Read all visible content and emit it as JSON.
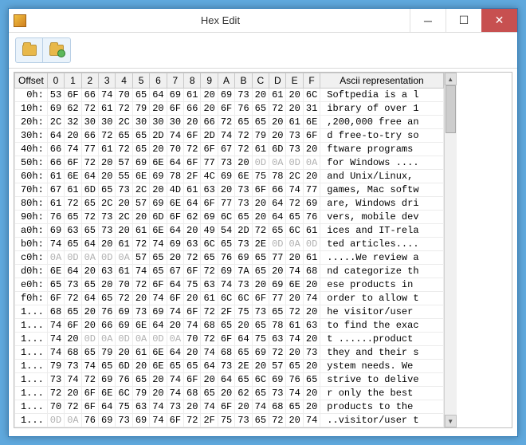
{
  "window": {
    "title": "Hex Edit"
  },
  "columns": {
    "offset": "Offset",
    "hex": [
      "0",
      "1",
      "2",
      "3",
      "4",
      "5",
      "6",
      "7",
      "8",
      "9",
      "A",
      "B",
      "C",
      "D",
      "E",
      "F"
    ],
    "ascii": "Ascii representation"
  },
  "rows": [
    {
      "offset": "0h:",
      "bytes": [
        "53",
        "6F",
        "66",
        "74",
        "70",
        "65",
        "64",
        "69",
        "61",
        "20",
        "69",
        "73",
        "20",
        "61",
        "20",
        "6C"
      ],
      "gray": [],
      "ascii": "Softpedia is a l"
    },
    {
      "offset": "10h:",
      "bytes": [
        "69",
        "62",
        "72",
        "61",
        "72",
        "79",
        "20",
        "6F",
        "66",
        "20",
        "6F",
        "76",
        "65",
        "72",
        "20",
        "31"
      ],
      "gray": [],
      "ascii": "ibrary of over 1"
    },
    {
      "offset": "20h:",
      "bytes": [
        "2C",
        "32",
        "30",
        "30",
        "2C",
        "30",
        "30",
        "30",
        "20",
        "66",
        "72",
        "65",
        "65",
        "20",
        "61",
        "6E"
      ],
      "gray": [],
      "ascii": ",200,000 free an"
    },
    {
      "offset": "30h:",
      "bytes": [
        "64",
        "20",
        "66",
        "72",
        "65",
        "65",
        "2D",
        "74",
        "6F",
        "2D",
        "74",
        "72",
        "79",
        "20",
        "73",
        "6F"
      ],
      "gray": [],
      "ascii": "d free-to-try so"
    },
    {
      "offset": "40h:",
      "bytes": [
        "66",
        "74",
        "77",
        "61",
        "72",
        "65",
        "20",
        "70",
        "72",
        "6F",
        "67",
        "72",
        "61",
        "6D",
        "73",
        "20"
      ],
      "gray": [],
      "ascii": "ftware programs "
    },
    {
      "offset": "50h:",
      "bytes": [
        "66",
        "6F",
        "72",
        "20",
        "57",
        "69",
        "6E",
        "64",
        "6F",
        "77",
        "73",
        "20",
        "0D",
        "0A",
        "0D",
        "0A"
      ],
      "gray": [
        12,
        13,
        14,
        15
      ],
      "ascii": "for Windows ...."
    },
    {
      "offset": "60h:",
      "bytes": [
        "61",
        "6E",
        "64",
        "20",
        "55",
        "6E",
        "69",
        "78",
        "2F",
        "4C",
        "69",
        "6E",
        "75",
        "78",
        "2C",
        "20"
      ],
      "gray": [],
      "ascii": "and Unix/Linux, "
    },
    {
      "offset": "70h:",
      "bytes": [
        "67",
        "61",
        "6D",
        "65",
        "73",
        "2C",
        "20",
        "4D",
        "61",
        "63",
        "20",
        "73",
        "6F",
        "66",
        "74",
        "77"
      ],
      "gray": [],
      "ascii": "games, Mac softw"
    },
    {
      "offset": "80h:",
      "bytes": [
        "61",
        "72",
        "65",
        "2C",
        "20",
        "57",
        "69",
        "6E",
        "64",
        "6F",
        "77",
        "73",
        "20",
        "64",
        "72",
        "69"
      ],
      "gray": [],
      "ascii": "are, Windows dri"
    },
    {
      "offset": "90h:",
      "bytes": [
        "76",
        "65",
        "72",
        "73",
        "2C",
        "20",
        "6D",
        "6F",
        "62",
        "69",
        "6C",
        "65",
        "20",
        "64",
        "65",
        "76"
      ],
      "gray": [],
      "ascii": "vers, mobile dev"
    },
    {
      "offset": "a0h:",
      "bytes": [
        "69",
        "63",
        "65",
        "73",
        "20",
        "61",
        "6E",
        "64",
        "20",
        "49",
        "54",
        "2D",
        "72",
        "65",
        "6C",
        "61"
      ],
      "gray": [],
      "ascii": "ices and IT-rela"
    },
    {
      "offset": "b0h:",
      "bytes": [
        "74",
        "65",
        "64",
        "20",
        "61",
        "72",
        "74",
        "69",
        "63",
        "6C",
        "65",
        "73",
        "2E",
        "0D",
        "0A",
        "0D"
      ],
      "gray": [
        13,
        14,
        15
      ],
      "ascii": "ted articles...."
    },
    {
      "offset": "c0h:",
      "bytes": [
        "0A",
        "0D",
        "0A",
        "0D",
        "0A",
        "57",
        "65",
        "20",
        "72",
        "65",
        "76",
        "69",
        "65",
        "77",
        "20",
        "61"
      ],
      "gray": [
        0,
        1,
        2,
        3,
        4
      ],
      "ascii": ".....We review a"
    },
    {
      "offset": "d0h:",
      "bytes": [
        "6E",
        "64",
        "20",
        "63",
        "61",
        "74",
        "65",
        "67",
        "6F",
        "72",
        "69",
        "7A",
        "65",
        "20",
        "74",
        "68"
      ],
      "gray": [],
      "ascii": "nd categorize th"
    },
    {
      "offset": "e0h:",
      "bytes": [
        "65",
        "73",
        "65",
        "20",
        "70",
        "72",
        "6F",
        "64",
        "75",
        "63",
        "74",
        "73",
        "20",
        "69",
        "6E",
        "20"
      ],
      "gray": [],
      "ascii": "ese products in "
    },
    {
      "offset": "f0h:",
      "bytes": [
        "6F",
        "72",
        "64",
        "65",
        "72",
        "20",
        "74",
        "6F",
        "20",
        "61",
        "6C",
        "6C",
        "6F",
        "77",
        "20",
        "74"
      ],
      "gray": [],
      "ascii": "order to allow t"
    },
    {
      "offset": "1...",
      "bytes": [
        "68",
        "65",
        "20",
        "76",
        "69",
        "73",
        "69",
        "74",
        "6F",
        "72",
        "2F",
        "75",
        "73",
        "65",
        "72",
        "20"
      ],
      "gray": [],
      "ascii": "he visitor/user "
    },
    {
      "offset": "1...",
      "bytes": [
        "74",
        "6F",
        "20",
        "66",
        "69",
        "6E",
        "64",
        "20",
        "74",
        "68",
        "65",
        "20",
        "65",
        "78",
        "61",
        "63"
      ],
      "gray": [],
      "ascii": "to find the exac"
    },
    {
      "offset": "1...",
      "bytes": [
        "74",
        "20",
        "0D",
        "0A",
        "0D",
        "0A",
        "0D",
        "0A",
        "70",
        "72",
        "6F",
        "64",
        "75",
        "63",
        "74",
        "20"
      ],
      "gray": [
        2,
        3,
        4,
        5,
        6,
        7
      ],
      "ascii": "t ......product "
    },
    {
      "offset": "1...",
      "bytes": [
        "74",
        "68",
        "65",
        "79",
        "20",
        "61",
        "6E",
        "64",
        "20",
        "74",
        "68",
        "65",
        "69",
        "72",
        "20",
        "73"
      ],
      "gray": [],
      "ascii": "they and their s"
    },
    {
      "offset": "1...",
      "bytes": [
        "79",
        "73",
        "74",
        "65",
        "6D",
        "20",
        "6E",
        "65",
        "65",
        "64",
        "73",
        "2E",
        "20",
        "57",
        "65",
        "20"
      ],
      "gray": [],
      "ascii": "ystem needs. We "
    },
    {
      "offset": "1...",
      "bytes": [
        "73",
        "74",
        "72",
        "69",
        "76",
        "65",
        "20",
        "74",
        "6F",
        "20",
        "64",
        "65",
        "6C",
        "69",
        "76",
        "65"
      ],
      "gray": [],
      "ascii": "strive to delive"
    },
    {
      "offset": "1...",
      "bytes": [
        "72",
        "20",
        "6F",
        "6E",
        "6C",
        "79",
        "20",
        "74",
        "68",
        "65",
        "20",
        "62",
        "65",
        "73",
        "74",
        "20"
      ],
      "gray": [],
      "ascii": "r only the best "
    },
    {
      "offset": "1...",
      "bytes": [
        "70",
        "72",
        "6F",
        "64",
        "75",
        "63",
        "74",
        "73",
        "20",
        "74",
        "6F",
        "20",
        "74",
        "68",
        "65",
        "20"
      ],
      "gray": [],
      "ascii": "products to the "
    },
    {
      "offset": "1...",
      "bytes": [
        "0D",
        "0A",
        "76",
        "69",
        "73",
        "69",
        "74",
        "6F",
        "72",
        "2F",
        "75",
        "73",
        "65",
        "72",
        "20",
        "74"
      ],
      "gray": [
        0,
        1
      ],
      "ascii": "..visitor/user t"
    }
  ]
}
